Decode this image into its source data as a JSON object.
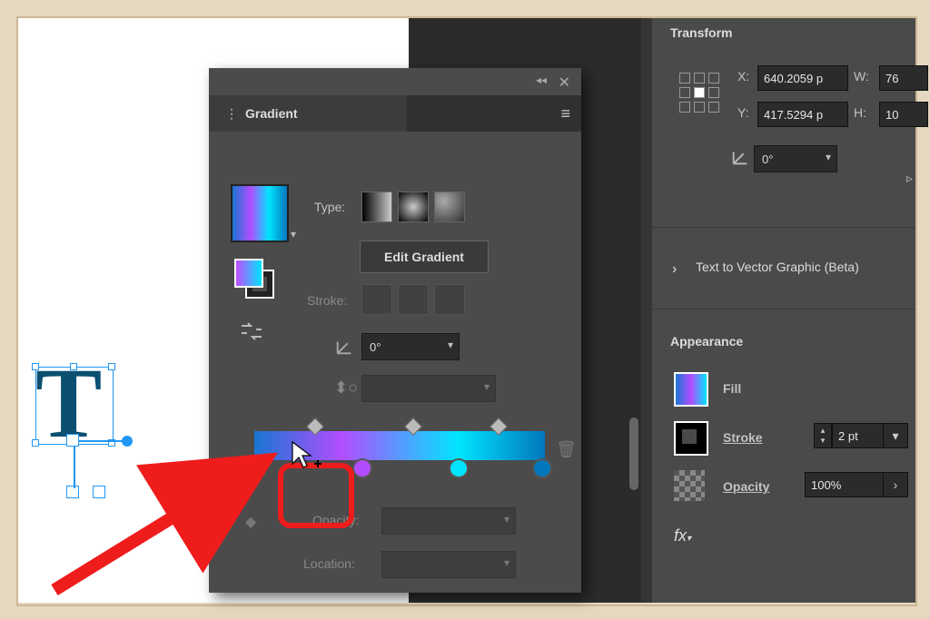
{
  "canvas_letter": "T",
  "gradient_panel": {
    "title": "Gradient",
    "type_label": "Type:",
    "edit_button": "Edit Gradient",
    "stroke_label": "Stroke:",
    "angle_value": "0°",
    "opacity_label": "Opacity:",
    "location_label": "Location:"
  },
  "highlight_tooltip": "cursor-add",
  "transform": {
    "title": "Transform",
    "x_label": "X:",
    "x_value": "640.2059 p",
    "y_label": "Y:",
    "y_value": "417.5294 p",
    "w_label": "W:",
    "w_value": "76",
    "h_label": "H:",
    "h_value": "10",
    "angle_value": "0°"
  },
  "text_to_vector": "Text to Vector Graphic (Beta)",
  "appearance": {
    "title": "Appearance",
    "fill_label": "Fill",
    "stroke_label": "Stroke",
    "stroke_value": "2 pt",
    "opacity_label": "Opacity",
    "opacity_value": "100%"
  }
}
